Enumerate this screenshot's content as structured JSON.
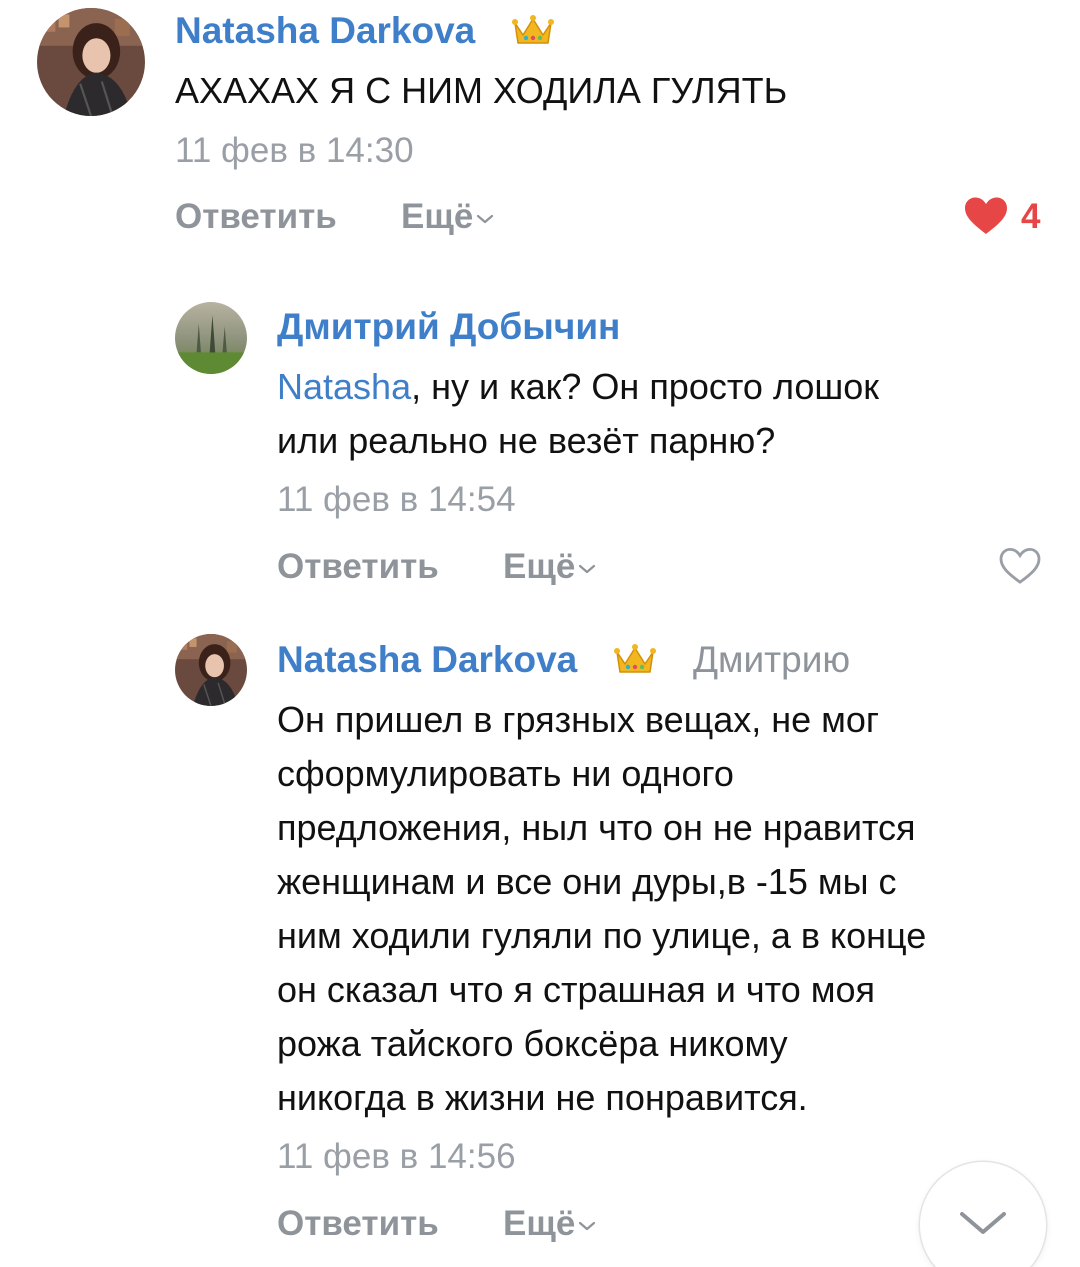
{
  "comments": [
    {
      "author": "Natasha Darkova",
      "text_lines": [
        "АХАХАХ Я С НИМ ХОДИЛА ГУЛЯТЬ"
      ],
      "date": "11 фев в 14:30",
      "reply_label": "Ответить",
      "more_label": "Ещё",
      "likes": "4",
      "liked": true
    },
    {
      "author": "Дмитрий Добычин",
      "mention": "Natasha",
      "text_lines": [
        ", ну и как? Он просто лошок",
        "или реально не везёт парню?"
      ],
      "date": "11 фев в 14:54",
      "reply_label": "Ответить",
      "more_label": "Ещё",
      "liked": false
    },
    {
      "author": "Natasha Darkova",
      "reply_to": "Дмитрию",
      "text_lines": [
        "Он пришел в грязных вещах, не мог",
        "сформулировать ни одного",
        "предложения, ныл что он не нравится",
        "женщинам и все они дуры,в -15 мы с",
        "ним ходили гуляли по улице, а в конце",
        "он сказал что я страшная и что моя",
        "рожа тайского боксёра никому",
        "никогда в жизни не понравится."
      ],
      "date": "11 фев в 14:56",
      "reply_label": "Ответить",
      "more_label": "Ещё"
    }
  ],
  "colors": {
    "link": "#3f7fc9",
    "muted": "#8e949a",
    "like": "#e64646",
    "text": "#111111"
  },
  "icons": [
    "crown-icon",
    "chevron-down-icon",
    "heart-filled-icon",
    "heart-outline-icon",
    "scroll-down-icon"
  ]
}
